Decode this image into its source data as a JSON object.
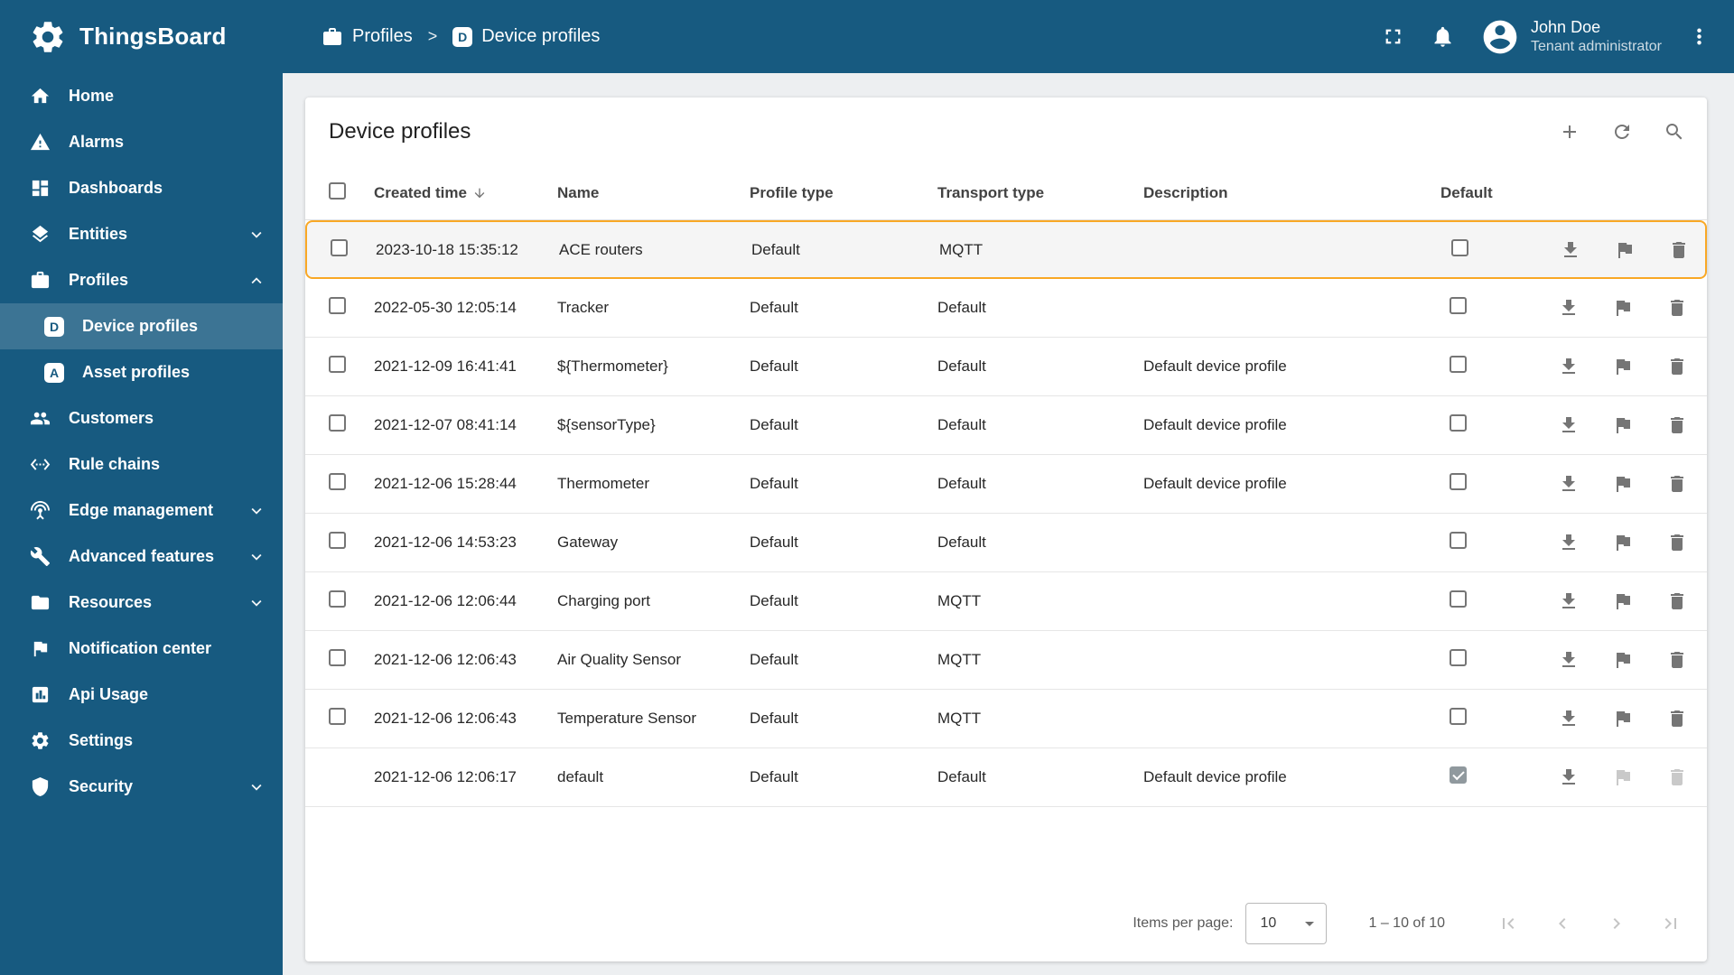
{
  "app": {
    "name": "ThingsBoard"
  },
  "colors": {
    "primary": "#175a80",
    "sidebar_active": "#3c7494",
    "row_highlight_border": "#f9a825",
    "content_background": "#edeff1"
  },
  "header": {
    "breadcrumb": [
      {
        "label": "Profiles",
        "icon": "briefcase-icon"
      },
      {
        "label": "Device profiles",
        "icon": "letter-d-icon",
        "icon_letter": "D"
      }
    ],
    "separator": ">",
    "actions": [
      "fullscreen-icon",
      "notifications-bell-icon",
      "more-vertical-icon"
    ],
    "user": {
      "name": "John Doe",
      "role": "Tenant administrator",
      "icon": "account-circle-icon"
    }
  },
  "sidebar": {
    "items": [
      {
        "label": "Home",
        "icon": "home-icon"
      },
      {
        "label": "Alarms",
        "icon": "warning-icon"
      },
      {
        "label": "Dashboards",
        "icon": "dashboards-icon"
      },
      {
        "label": "Entities",
        "icon": "layers-icon",
        "chevron": "down"
      },
      {
        "label": "Profiles",
        "icon": "briefcase-icon",
        "chevron": "up"
      },
      {
        "label": "Device profiles",
        "icon": "letter-d-icon",
        "icon_letter": "D",
        "sub": true,
        "active": true
      },
      {
        "label": "Asset profiles",
        "icon": "letter-a-icon",
        "icon_letter": "A",
        "sub": true
      },
      {
        "label": "Customers",
        "icon": "people-icon"
      },
      {
        "label": "Rule chains",
        "icon": "code-brackets-icon"
      },
      {
        "label": "Edge management",
        "icon": "antenna-icon",
        "chevron": "down"
      },
      {
        "label": "Advanced features",
        "icon": "wrench-icon",
        "chevron": "down"
      },
      {
        "label": "Resources",
        "icon": "folder-icon",
        "chevron": "down"
      },
      {
        "label": "Notification center",
        "icon": "flag-icon"
      },
      {
        "label": "Api Usage",
        "icon": "bar-chart-icon"
      },
      {
        "label": "Settings",
        "icon": "gear-icon"
      },
      {
        "label": "Security",
        "icon": "shield-icon",
        "chevron": "down"
      }
    ]
  },
  "page": {
    "title": "Device profiles",
    "card_actions": [
      "add-icon",
      "refresh-icon",
      "search-icon"
    ]
  },
  "table": {
    "columns": [
      "Created time",
      "Name",
      "Profile type",
      "Transport type",
      "Description",
      "Default"
    ],
    "sorted_by": "Created time",
    "sort_direction": "desc",
    "row_action_icons": [
      "download-icon",
      "flag-icon",
      "trash-icon"
    ],
    "rows": [
      {
        "created": "2023-10-18 15:35:12",
        "name": "ACE routers",
        "profile_type": "Default",
        "transport_type": "MQTT",
        "description": "",
        "default": false,
        "highlighted": true
      },
      {
        "created": "2022-05-30 12:05:14",
        "name": "Tracker",
        "profile_type": "Default",
        "transport_type": "Default",
        "description": "",
        "default": false
      },
      {
        "created": "2021-12-09 16:41:41",
        "name": "${Thermometer}",
        "profile_type": "Default",
        "transport_type": "Default",
        "description": "Default device profile",
        "default": false
      },
      {
        "created": "2021-12-07 08:41:14",
        "name": "${sensorType}",
        "profile_type": "Default",
        "transport_type": "Default",
        "description": "Default device profile",
        "default": false
      },
      {
        "created": "2021-12-06 15:28:44",
        "name": "Thermometer",
        "profile_type": "Default",
        "transport_type": "Default",
        "description": "Default device profile",
        "default": false
      },
      {
        "created": "2021-12-06 14:53:23",
        "name": "Gateway",
        "profile_type": "Default",
        "transport_type": "Default",
        "description": "",
        "default": false
      },
      {
        "created": "2021-12-06 12:06:44",
        "name": "Charging port",
        "profile_type": "Default",
        "transport_type": "MQTT",
        "description": "",
        "default": false
      },
      {
        "created": "2021-12-06 12:06:43",
        "name": "Air Quality Sensor",
        "profile_type": "Default",
        "transport_type": "MQTT",
        "description": "",
        "default": false
      },
      {
        "created": "2021-12-06 12:06:43",
        "name": "Temperature Sensor",
        "profile_type": "Default",
        "transport_type": "MQTT",
        "description": "",
        "default": false
      },
      {
        "created": "2021-12-06 12:06:17",
        "name": "default",
        "profile_type": "Default",
        "transport_type": "Default",
        "description": "Default device profile",
        "default": true,
        "actions_disabled": true,
        "no_row_checkbox": true
      }
    ]
  },
  "footer": {
    "items_per_page_label": "Items per page:",
    "items_per_page_value": "10",
    "range_label": "1 – 10 of 10"
  }
}
